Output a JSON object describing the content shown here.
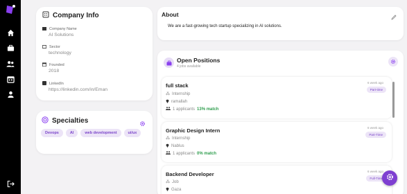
{
  "company_info": {
    "title": "Company Info",
    "items": [
      {
        "label": "Company Name",
        "value": "AI Solutions"
      },
      {
        "label": "Sector",
        "value": "technology"
      },
      {
        "label": "Founded",
        "value": "2018"
      },
      {
        "label": "LinkedIn",
        "value": "https://linkedin.com/in/Eman"
      }
    ]
  },
  "specialties": {
    "title": "Specialties",
    "tags": [
      "Devops",
      "AI",
      "web development",
      "ui/ux"
    ]
  },
  "about": {
    "title": "About",
    "text": "We are a fast-growing tech startup specializing in AI solutions."
  },
  "positions": {
    "title": "Open Positions",
    "subtitle": "4 jobs available",
    "jobs": [
      {
        "title": "full stack",
        "type": "Internship",
        "location": "ramallah",
        "applicants": "1 applicants",
        "match": "13% match",
        "time": "6 week ago",
        "badge": "Part-time"
      },
      {
        "title": "Graphic Design Intern",
        "type": "Internship",
        "location": "Nablus",
        "applicants": "1 applicants",
        "match": "0% match",
        "time": "6 week ago",
        "badge": "Part-Time"
      },
      {
        "title": "Backend Developer",
        "type": "Job",
        "location": "Gaza",
        "time": "6 week ago",
        "badge": "Full-Time"
      }
    ]
  },
  "colors": {
    "accent": "#7e3fd1",
    "sidebar": "#000000",
    "match": "#2e9d4d"
  }
}
